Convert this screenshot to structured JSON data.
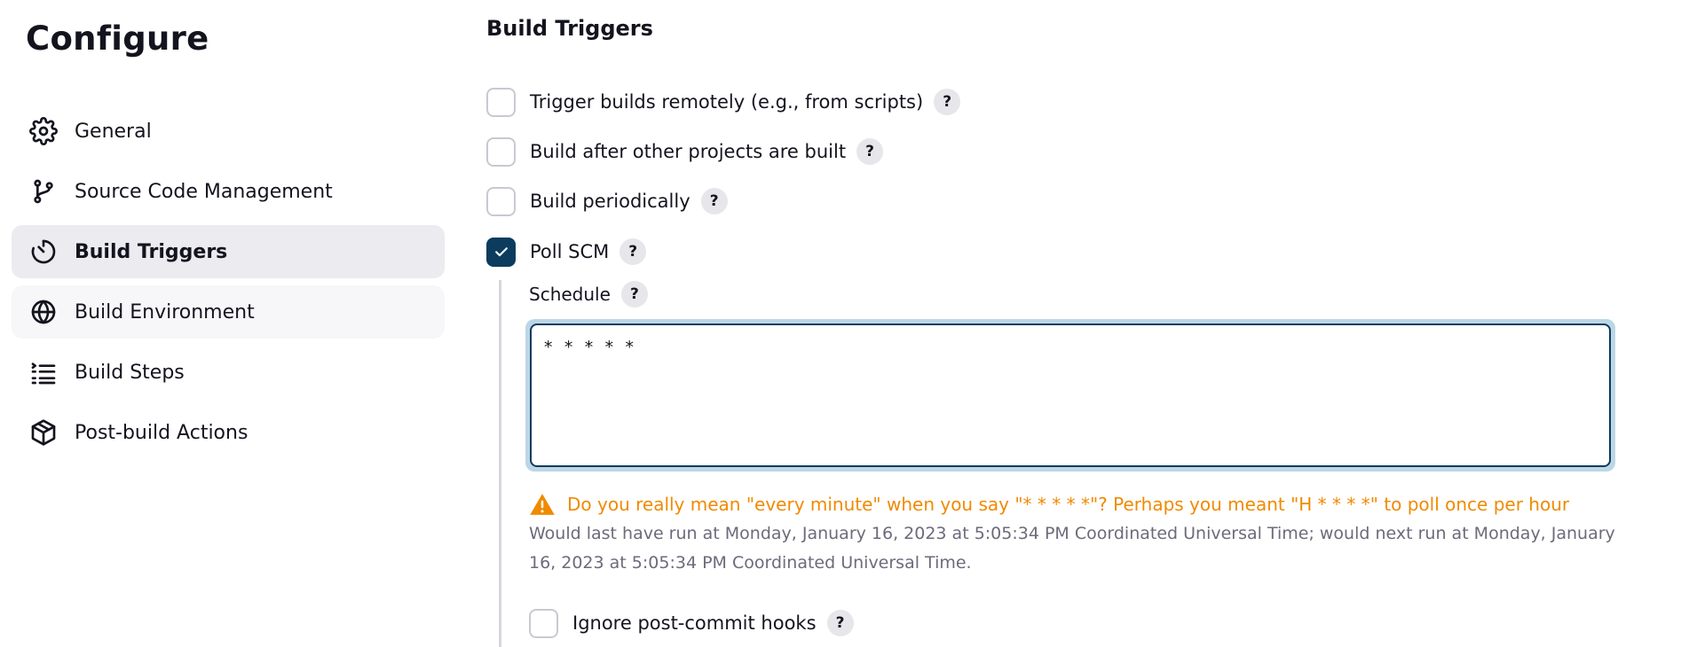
{
  "sidebar": {
    "title": "Configure",
    "items": [
      {
        "label": "General",
        "icon": "gear-icon"
      },
      {
        "label": "Source Code Management",
        "icon": "git-branch-icon"
      },
      {
        "label": "Build Triggers",
        "icon": "timer-icon"
      },
      {
        "label": "Build Environment",
        "icon": "globe-icon"
      },
      {
        "label": "Build Steps",
        "icon": "list-icon"
      },
      {
        "label": "Post-build Actions",
        "icon": "package-icon"
      }
    ],
    "active_item": "Build Triggers"
  },
  "main": {
    "section_title": "Build Triggers",
    "help_glyph": "?",
    "options": [
      {
        "label": "Trigger builds remotely (e.g., from scripts)",
        "checked": false
      },
      {
        "label": "Build after other projects are built",
        "checked": false
      },
      {
        "label": "Build periodically",
        "checked": false
      },
      {
        "label": "Poll SCM",
        "checked": true
      }
    ],
    "poll_scm": {
      "schedule_label": "Schedule",
      "schedule_value": "* * * * *",
      "warning": "Do you really mean \"every minute\" when you say \"* * * * *\"? Perhaps you meant \"H * * * *\" to poll once per hour",
      "info": "Would last have run at Monday, January 16, 2023 at 5:05:34 PM Coordinated Universal Time; would next run at Monday, January 16, 2023 at 5:05:34 PM Coordinated Universal Time.",
      "ignore_hooks": {
        "label": "Ignore post-commit hooks",
        "checked": false
      }
    }
  },
  "colors": {
    "checked_fill": "#0b3c5d",
    "warning": "#f08a00",
    "active_nav_bg": "#ebebf0",
    "focus_ring": "#bcd6e6"
  }
}
